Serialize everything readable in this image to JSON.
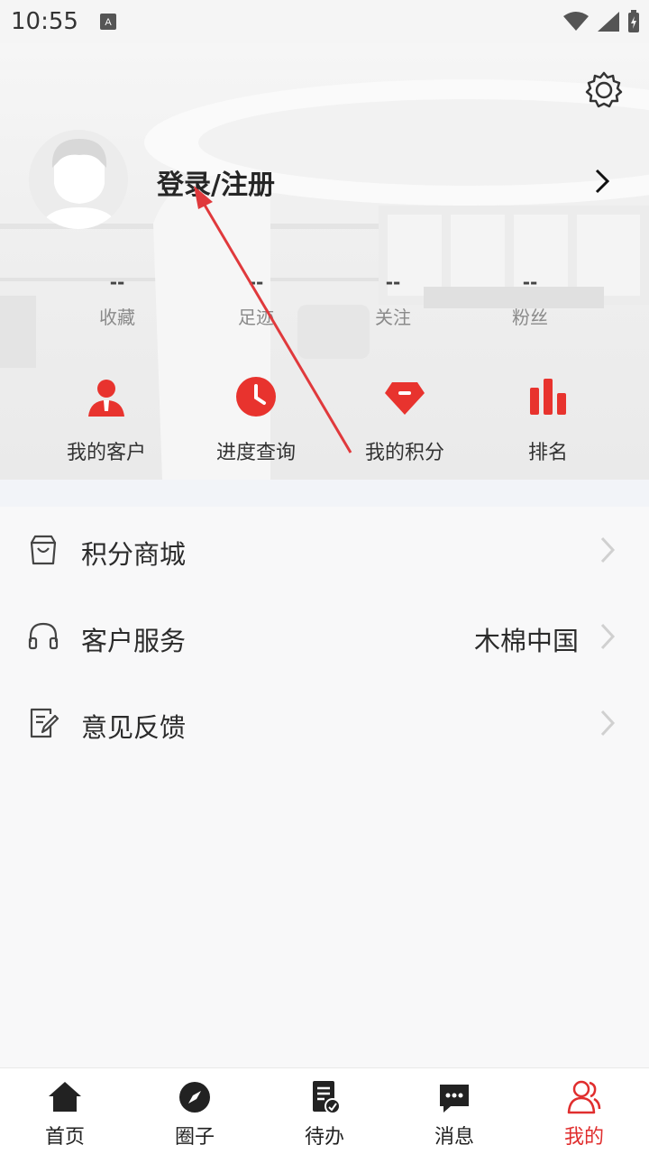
{
  "status_bar": {
    "time": "10:55"
  },
  "profile": {
    "login_label": "登录/注册"
  },
  "stats": [
    {
      "value": "--",
      "label": "收藏"
    },
    {
      "value": "--",
      "label": "足迹"
    },
    {
      "value": "--",
      "label": "关注"
    },
    {
      "value": "--",
      "label": "粉丝"
    }
  ],
  "shortcuts": [
    {
      "label": "我的客户",
      "icon": "customer-icon"
    },
    {
      "label": "进度查询",
      "icon": "clock-icon"
    },
    {
      "label": "我的积分",
      "icon": "diamond-icon"
    },
    {
      "label": "排名",
      "icon": "bar-chart-icon"
    }
  ],
  "menu": [
    {
      "label": "积分商城",
      "value": "",
      "icon": "shopping-bag-icon"
    },
    {
      "label": "客户服务",
      "value": "木棉中国",
      "icon": "headset-icon"
    },
    {
      "label": "意见反馈",
      "value": "",
      "icon": "feedback-icon"
    }
  ],
  "bottom_nav": [
    {
      "label": "首页",
      "icon": "home-icon",
      "active": false
    },
    {
      "label": "圈子",
      "icon": "compass-icon",
      "active": false
    },
    {
      "label": "待办",
      "icon": "todo-icon",
      "active": false
    },
    {
      "label": "消息",
      "icon": "message-icon",
      "active": false
    },
    {
      "label": "我的",
      "icon": "user-icon",
      "active": true
    }
  ],
  "colors": {
    "accent": "#e02e2e",
    "text": "#222222",
    "muted": "#8a8a8a"
  }
}
